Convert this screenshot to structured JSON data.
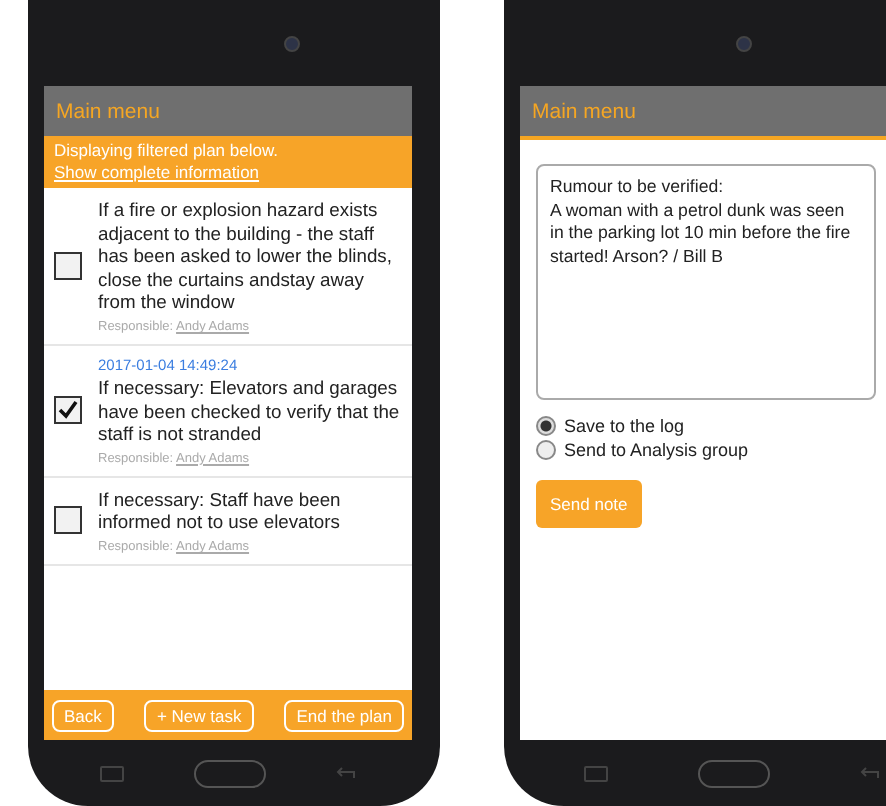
{
  "phones": [
    {
      "screen": {
        "kind": "task_list",
        "header": {
          "title": "Main menu"
        },
        "banner": {
          "text": "Displaying filtered plan below.",
          "link": "Show complete information"
        },
        "tasks": [
          {
            "text": "If a fire or explosion hazard exists adjacent to the building - the staff has been asked to lower the blinds, close the curtains andstay away from the window",
            "checked": false,
            "responsible_label": "Responsible:",
            "responsible_name": "Andy Adams"
          },
          {
            "timestamp": "2017-01-04 14:49:24",
            "text": "If necessary: Elevators and garages have been checked to verify that the staff is not stranded",
            "checked": true,
            "responsible_label": "Responsible:",
            "responsible_name": "Andy Adams"
          },
          {
            "text": "If necessary: Staff have been informed not to use elevators",
            "checked": false,
            "responsible_label": "Responsible:",
            "responsible_name": "Andy Adams"
          }
        ],
        "footer_buttons": [
          "Back",
          "+ New task",
          "End the plan"
        ]
      }
    },
    {
      "screen": {
        "kind": "note",
        "header": {
          "title": "Main menu"
        },
        "note": {
          "value": "Rumour to be verified:\nA woman with a petrol dunk was seen in the parking lot 10 min before the fire started! Arson? / Bill B"
        },
        "options": [
          {
            "label": "Save to the log",
            "selected": true
          },
          {
            "label": "Send to Analysis group",
            "selected": false
          }
        ],
        "send_button": "Send note"
      }
    }
  ]
}
